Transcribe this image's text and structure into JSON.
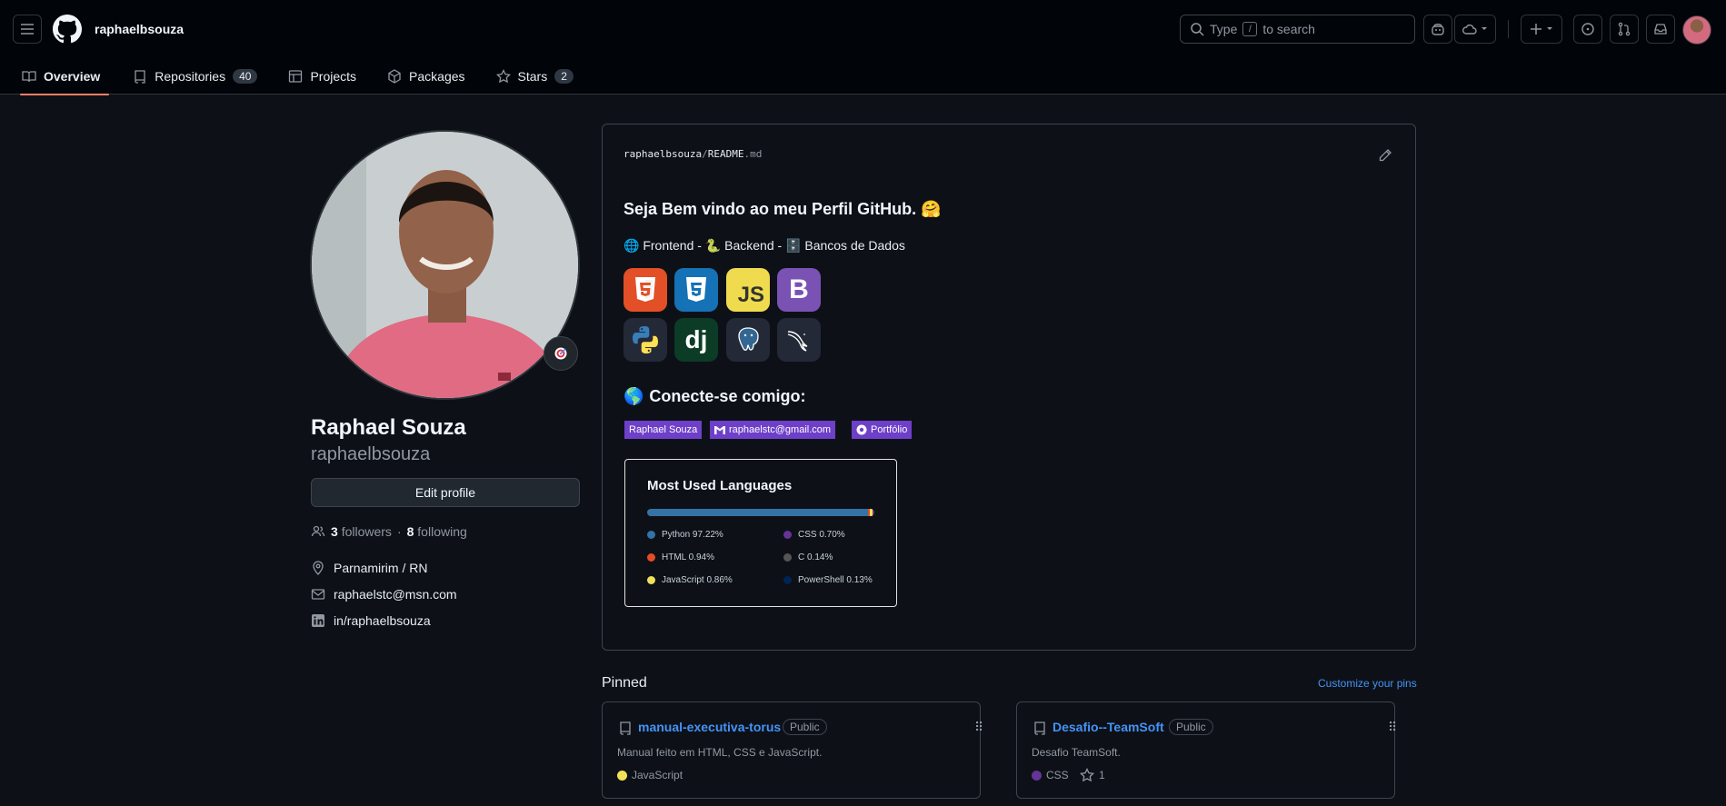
{
  "header": {
    "username": "raphaelbsouza",
    "search_prefix": "Type",
    "search_key": "/",
    "search_suffix": "to search"
  },
  "tabs": [
    {
      "label": "Overview"
    },
    {
      "label": "Repositories",
      "count": "40"
    },
    {
      "label": "Projects"
    },
    {
      "label": "Packages"
    },
    {
      "label": "Stars",
      "count": "2"
    }
  ],
  "profile": {
    "name": "Raphael Souza",
    "login": "raphaelbsouza",
    "edit_label": "Edit profile",
    "followers_count": "3",
    "followers_label": "followers",
    "separator": "·",
    "following_count": "8",
    "following_label": "following",
    "location": "Parnamirim / RN",
    "email": "raphaelstc@msn.com",
    "linkedin": "in/raphaelbsouza"
  },
  "readme": {
    "path_user": "raphaelbsouza",
    "path_sep": "/",
    "path_file": "README",
    "path_ext": ".md",
    "heading": "Seja Bem vindo ao meu Perfil GitHub. 🤗",
    "stack_line": "🌐 Frontend - 🐍 Backend - 🗄️ Bancos de Dados",
    "tech_icons": [
      "html5-icon",
      "css3-icon",
      "javascript-icon",
      "bootstrap-icon",
      "python-icon",
      "django-icon",
      "postgresql-icon",
      "mysql-icon"
    ],
    "tech_labels": {
      "js": "JS",
      "bootstrap": "B",
      "django": "dj"
    },
    "connect_emoji": "🌎",
    "connect_heading": "Conecte-se comigo:",
    "badges": [
      "Raphael Souza",
      "raphaelstc@gmail.com",
      "Portfólio"
    ],
    "lang_card": {
      "title": "Most Used Languages",
      "languages": [
        {
          "name": "Python",
          "percent": "97.22%",
          "value": 97.22,
          "color": "#3572A5"
        },
        {
          "name": "CSS",
          "percent": "0.70%",
          "value": 0.7,
          "color": "#663399"
        },
        {
          "name": "HTML",
          "percent": "0.94%",
          "value": 0.94,
          "color": "#e34c26"
        },
        {
          "name": "C",
          "percent": "0.14%",
          "value": 0.14,
          "color": "#555555"
        },
        {
          "name": "JavaScript",
          "percent": "0.86%",
          "value": 0.86,
          "color": "#f1e05a"
        },
        {
          "name": "PowerShell",
          "percent": "0.13%",
          "value": 0.13,
          "color": "#012456"
        }
      ]
    }
  },
  "pinned": {
    "title": "Pinned",
    "customize": "Customize your pins",
    "repos": [
      {
        "name": "manual-executiva-torus",
        "visibility": "Public",
        "description": "Manual feito em HTML, CSS e JavaScript.",
        "language": "JavaScript",
        "language_color": "#f1e05a"
      },
      {
        "name": "Desafio--TeamSoft",
        "visibility": "Public",
        "description": "Desafio TeamSoft.",
        "language": "CSS",
        "language_color": "#663399",
        "stars": "1"
      }
    ]
  }
}
